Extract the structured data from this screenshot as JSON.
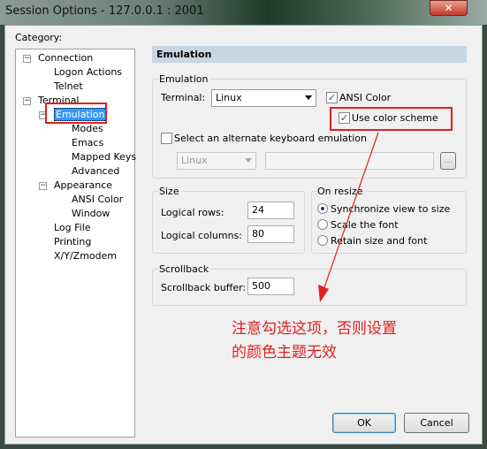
{
  "window": {
    "title": "Session Options - 127.0.0.1 : 2001",
    "close_icon": "close-icon"
  },
  "category_label": "Category:",
  "tree": [
    {
      "label": "Connection",
      "level": 0,
      "expander": "⊟"
    },
    {
      "label": "Logon Actions",
      "level": 1
    },
    {
      "label": "Telnet",
      "level": 1
    },
    {
      "label": "Terminal",
      "level": 0,
      "expander": "⊟"
    },
    {
      "label": "Emulation",
      "level": 1,
      "expander": "⊟",
      "selected": true
    },
    {
      "label": "Modes",
      "level": 2
    },
    {
      "label": "Emacs",
      "level": 2
    },
    {
      "label": "Mapped Keys",
      "level": 2
    },
    {
      "label": "Advanced",
      "level": 2
    },
    {
      "label": "Appearance",
      "level": 1,
      "expander": "⊟"
    },
    {
      "label": "ANSI Color",
      "level": 2
    },
    {
      "label": "Window",
      "level": 2
    },
    {
      "label": "Log File",
      "level": 1
    },
    {
      "label": "Printing",
      "level": 1
    },
    {
      "label": "X/Y/Zmodem",
      "level": 1
    }
  ],
  "panel": {
    "header": "Emulation",
    "emulation": {
      "group": "Emulation",
      "terminal_label": "Terminal:",
      "terminal_value": "Linux",
      "ansi_color_label": "ANSI Color",
      "ansi_color_checked": true,
      "use_color_scheme_label": "Use color scheme",
      "use_color_scheme_checked": true,
      "alt_keyboard_label": "Select an alternate keyboard emulation",
      "alt_keyboard_checked": false,
      "alt_keyboard_value": "Linux",
      "browse_label": "..."
    },
    "size": {
      "group": "Size",
      "rows_label": "Logical rows:",
      "rows_value": "24",
      "cols_label": "Logical columns:",
      "cols_value": "80"
    },
    "resize": {
      "group": "On resize",
      "options": [
        "Synchronize view to size",
        "Scale the font",
        "Retain size and font"
      ],
      "selected": 0
    },
    "scrollback": {
      "group": "Scrollback",
      "buffer_label": "Scrollback buffer:",
      "buffer_value": "500"
    }
  },
  "annotation": {
    "line1": "注意勾选这项，否则设置",
    "line2": "的颜色主题无效",
    "color": "#e02020"
  },
  "buttons": {
    "ok": "OK",
    "cancel": "Cancel"
  }
}
